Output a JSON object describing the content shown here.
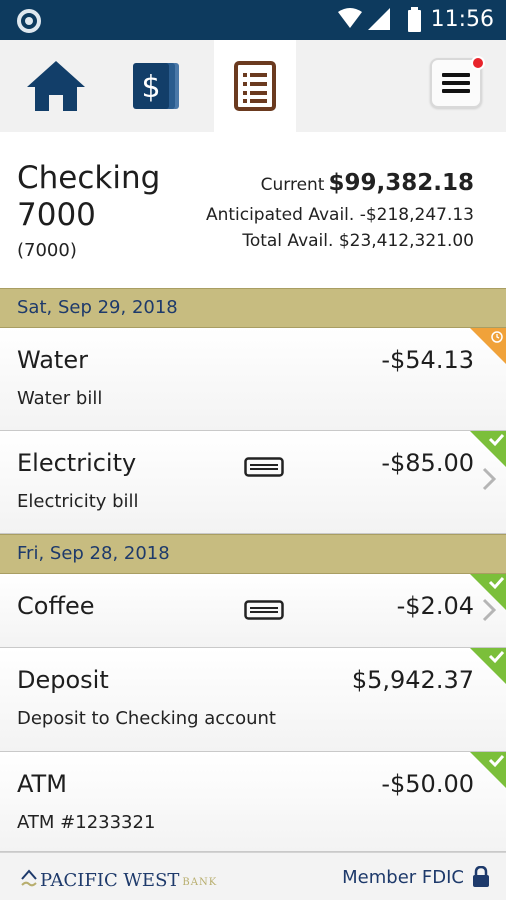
{
  "status_bar": {
    "time": "11:56"
  },
  "nav": {
    "tabs": [
      {
        "icon": "home-icon"
      },
      {
        "icon": "dollar-card-icon"
      },
      {
        "icon": "transactions-list-icon",
        "selected": true
      }
    ],
    "menu_icon": "hamburger-menu-icon",
    "notification_color": "#e8242b"
  },
  "account": {
    "name": "Checking 7000",
    "number": "(7000)",
    "current_label": "Current",
    "current_value": "$99,382.18",
    "anticipated_label": "Anticipated Avail.",
    "anticipated_value": "-$218,247.13",
    "total_label": "Total Avail.",
    "total_value": "$23,412,321.00"
  },
  "groups": [
    {
      "date": "Sat, Sep 29, 2018",
      "transactions": [
        {
          "name": "Water",
          "description": "Water bill",
          "amount": "-$54.13",
          "status": "pending"
        },
        {
          "name": "Electricity",
          "description": "Electricity bill",
          "amount": "-$85.00",
          "status": "cleared",
          "card": true,
          "chevron": true
        }
      ]
    },
    {
      "date": "Fri, Sep 28, 2018",
      "transactions": [
        {
          "name": "Coffee",
          "description": "",
          "amount": "-$2.04",
          "status": "cleared",
          "card": true,
          "chevron": true
        },
        {
          "name": "Deposit",
          "description": "Deposit to Checking account",
          "amount": "$5,942.37",
          "status": "cleared"
        },
        {
          "name": "ATM",
          "description": "ATM #1233321",
          "amount": "-$50.00",
          "status": "cleared"
        }
      ]
    }
  ],
  "footer": {
    "logo_text": "PACIFIC WEST",
    "logo_suffix": "BANK",
    "member_text": "Member FDIC"
  },
  "colors": {
    "brand_navy": "#0d3a5e",
    "date_header": "#c7bc80",
    "cleared": "#7bbf3a",
    "pending": "#f0a23a"
  }
}
